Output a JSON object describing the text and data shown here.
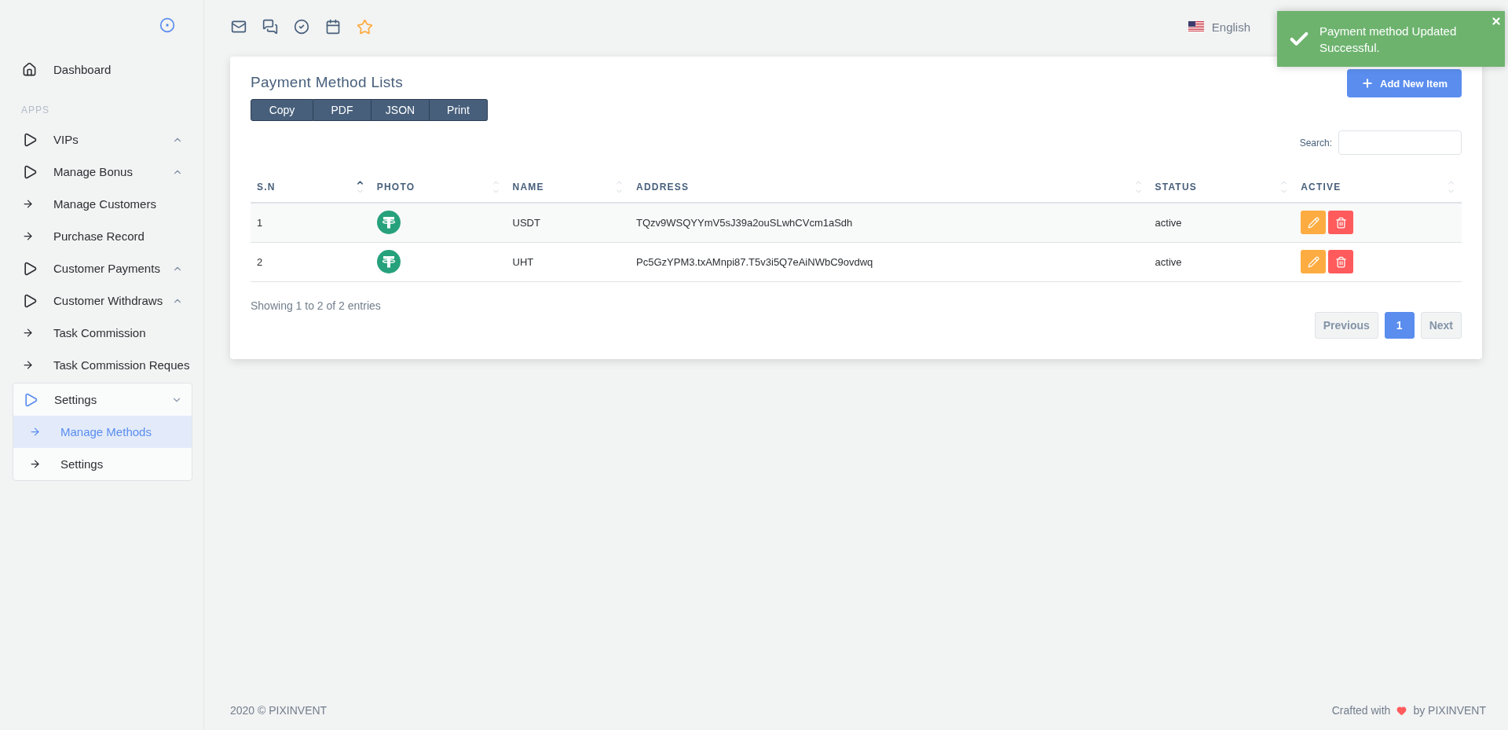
{
  "sidebar": {
    "items": [
      {
        "kind": "home",
        "label": "Dashboard"
      },
      {
        "kind": "section",
        "label": "APPS"
      },
      {
        "kind": "group",
        "label": "VIPs",
        "expanded": false
      },
      {
        "kind": "group",
        "label": "Manage Bonus",
        "expanded": false
      },
      {
        "kind": "link",
        "label": "Manage Customers"
      },
      {
        "kind": "link",
        "label": "Purchase Record"
      },
      {
        "kind": "group",
        "label": "Customer Payments",
        "expanded": false
      },
      {
        "kind": "group",
        "label": "Customer Withdraws",
        "expanded": false
      },
      {
        "kind": "link",
        "label": "Task Commission"
      },
      {
        "kind": "link",
        "label": "Task Commission Reques"
      },
      {
        "kind": "group",
        "label": "Settings",
        "expanded": true,
        "children": [
          {
            "label": "Manage Methods",
            "selected": true
          },
          {
            "label": "Settings",
            "selected": false
          }
        ]
      }
    ]
  },
  "navbar": {
    "language": "English"
  },
  "toast": {
    "message": "Payment method Updated Successful."
  },
  "card": {
    "title": "Payment Method Lists",
    "export_buttons": [
      "Copy",
      "PDF",
      "JSON",
      "Print"
    ],
    "add_button": "Add New Item",
    "search": {
      "label": "Search:"
    },
    "table": {
      "columns": [
        {
          "label": "S.N",
          "sorted": true
        },
        {
          "label": "PHOTO",
          "sorted": false
        },
        {
          "label": "NAME",
          "sorted": false
        },
        {
          "label": "ADDRESS",
          "sorted": false
        },
        {
          "label": "STATUS",
          "sorted": false
        },
        {
          "label": "ACTIVE",
          "sorted": false
        }
      ],
      "rows": [
        {
          "sn": "1",
          "name": "USDT",
          "address": "TQzv9WSQYYmV5sJ39a2ouSLwhCVcm1aSdh",
          "status": "active"
        },
        {
          "sn": "2",
          "name": "UHT",
          "address": "Pc5GzYPM3.txAMnpi87.T5v3i5Q7eAiNWbC9ovdwq",
          "status": "active"
        }
      ]
    },
    "info": "Showing 1 to 2 of 2 entries",
    "pagination": [
      {
        "label": "Previous",
        "selected": false
      },
      {
        "label": "1",
        "selected": true
      },
      {
        "label": "Next",
        "selected": false
      }
    ]
  },
  "footer": {
    "copyright": "2020 © PIXINVENT",
    "crafted_prefix": "Crafted with",
    "crafted_suffix": "by PIXINVENT"
  }
}
